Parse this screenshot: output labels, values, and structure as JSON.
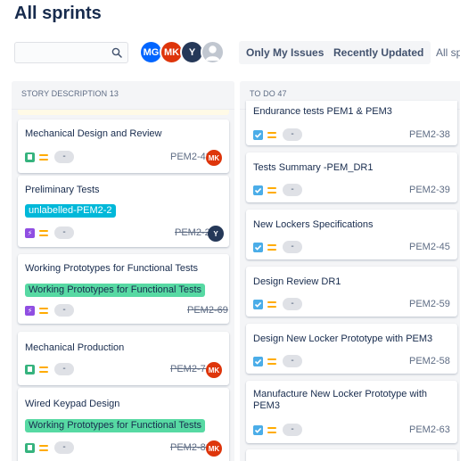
{
  "page": {
    "title": "All sprints"
  },
  "toolbar": {
    "search_value": "",
    "search_icon": "search-icon",
    "avatars": [
      "MG",
      "MK",
      "Y",
      ""
    ],
    "filters": [
      "Only My Issues",
      "Recently Updated",
      "All sp"
    ]
  },
  "columns": [
    {
      "header": "STORY DESCRIPTION 13",
      "cards": [
        {
          "title": "Mechanical Design and Review",
          "label": "",
          "type": "story",
          "estimate": "-",
          "key": "PEM2-43",
          "key_done": false,
          "assignee": "MK"
        },
        {
          "title": "Preliminary Tests",
          "label": "unlabelled-PEM2-2",
          "type": "epic",
          "estimate": "-",
          "key": "PEM2-2",
          "key_done": true,
          "assignee": "Y"
        },
        {
          "title": "Working Prototypes for Functional Tests",
          "label": "Working Prototypes for Functional Tests",
          "type": "epic",
          "estimate": "-",
          "key": "PEM2-69",
          "key_done": true,
          "assignee": ""
        },
        {
          "title": "Mechanical Production",
          "label": "",
          "type": "story",
          "estimate": "-",
          "key": "PEM2-74",
          "key_done": true,
          "assignee": "MK"
        },
        {
          "title": "Wired Keypad Design",
          "label": "Working Prototypes for Functional Tests",
          "type": "story",
          "estimate": "-",
          "key": "PEM2-80",
          "key_done": true,
          "assignee": "MK"
        }
      ]
    },
    {
      "header": "TO DO 47",
      "cards": [
        {
          "title": "Endurance tests PEM1 & PEM3",
          "type": "task",
          "estimate": "-",
          "key": "PEM2-38"
        },
        {
          "title": "Tests Summary -PEM_DR1",
          "type": "task",
          "estimate": "-",
          "key": "PEM2-39"
        },
        {
          "title": "New Lockers Specifications",
          "type": "task",
          "estimate": "-",
          "key": "PEM2-45"
        },
        {
          "title": "Design Review DR1",
          "type": "task",
          "estimate": "-",
          "key": "PEM2-59"
        },
        {
          "title": "Design New Locker Prototype with PEM3",
          "type": "task",
          "estimate": "-",
          "key": "PEM2-58"
        },
        {
          "title": "Manufacture New Locker Prototype with PEM3",
          "type": "task",
          "estimate": "-",
          "key": "PEM2-63"
        }
      ]
    }
  ],
  "colors": {
    "accent_blue": "#0065ff",
    "story_green": "#36b37e",
    "epic_purple": "#904ee2",
    "task_blue": "#4bade8",
    "priority_yellow": "#ffab00",
    "label_teal": "#00b8d9",
    "label_green": "#57d9a3",
    "avatar_red": "#de350b",
    "avatar_navy": "#253858"
  }
}
